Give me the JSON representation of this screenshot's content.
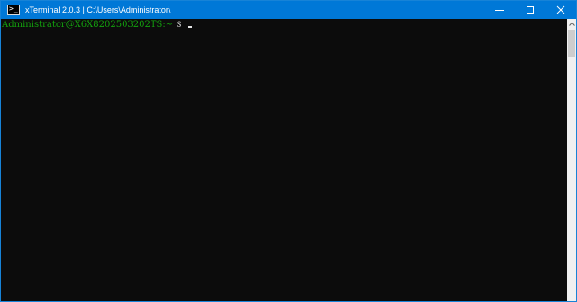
{
  "window": {
    "title": "xTerminal 2.0.3 | C:\\Users\\Administrator\\",
    "accent_color": "#0078d7",
    "controls": {
      "minimize_icon": "minimize-icon",
      "maximize_icon": "maximize-icon",
      "close_icon": "close-icon"
    }
  },
  "terminal": {
    "background": "#0c0c0c",
    "prompt_user": "Administrator@X6X8202503202TS:~",
    "prompt_symbol": " $",
    "user_color": "#13a10e"
  }
}
